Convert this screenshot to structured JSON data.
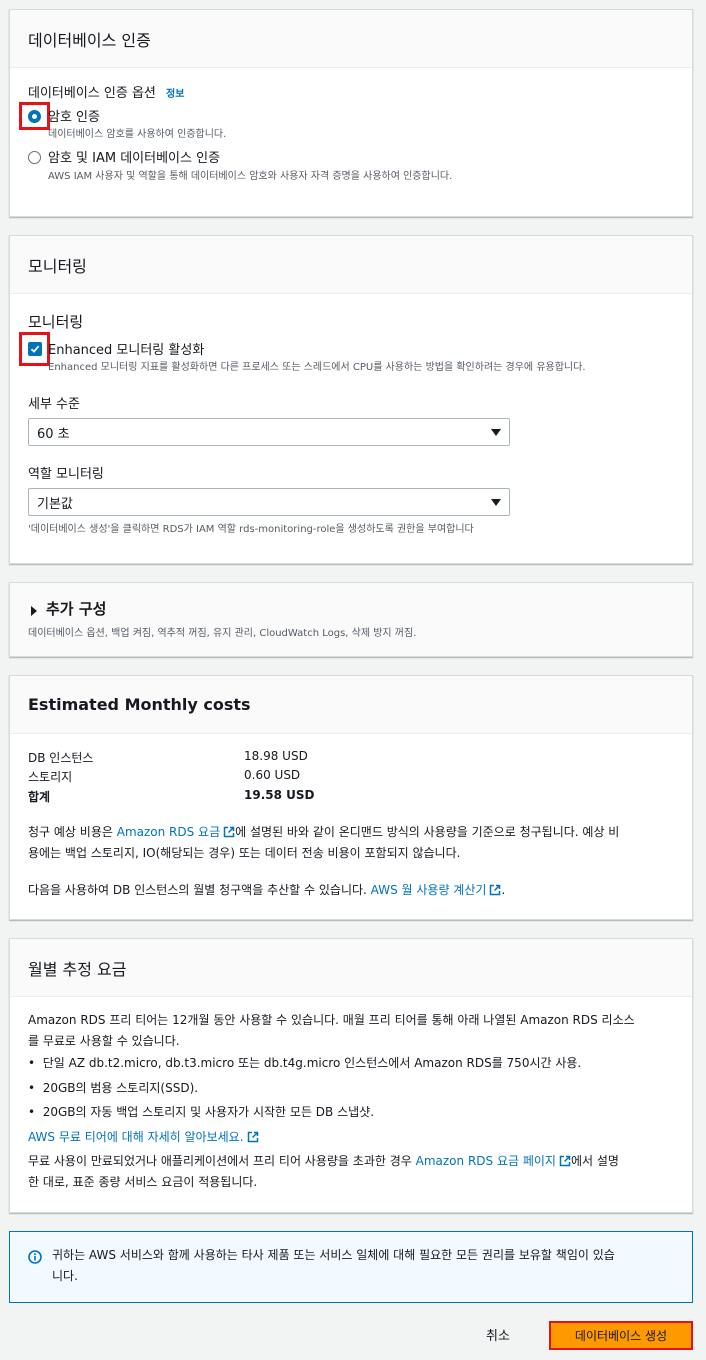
{
  "auth": {
    "title": "데이터베이스 인증",
    "options_label": "데이터베이스 인증 옵션",
    "info_link": "정보",
    "option1_label": "암호 인증",
    "option1_desc": "데이터베이스 암호를 사용하여 인증합니다.",
    "option2_label": "암호 및 IAM 데이터베이스 인증",
    "option2_desc": "AWS IAM 사용자 및 역할을 통해 데이터베이스 암호와 사용자 자격 증명을 사용하여 인증합니다."
  },
  "monitoring": {
    "title": "모니터링",
    "section_label": "모니터링",
    "enhanced_label": "Enhanced 모니터링 활성화",
    "enhanced_desc": "Enhanced 모니터링 지표를 활성화하면 다른 프로세스 또는 스레드에서 CPU를 사용하는 방법을 확인하려는 경우에 유용합니다.",
    "granularity_label": "세부 수준",
    "granularity_value": "60 초",
    "role_label": "역할 모니터링",
    "role_value": "기본값",
    "role_hint": "'데이터베이스 생성'을 클릭하면 RDS가 IAM 역할 rds-monitoring-role을 생성하도록 권한을 부여합니다"
  },
  "additional": {
    "title": "추가 구성",
    "desc": "데이터베이스 옵션, 백업 켜짐, 역추적 꺼짐, 유지 관리, CloudWatch Logs, 삭제 방지 꺼짐."
  },
  "costs": {
    "title": "Estimated Monthly costs",
    "rows": [
      {
        "label": "DB 인스턴스",
        "value": "18.98 USD"
      },
      {
        "label": "스토리지",
        "value": "0.60 USD"
      },
      {
        "label": "합계",
        "value": "19.58 USD"
      }
    ],
    "note1_a": "청구 예상 비용은 ",
    "note1_link": "Amazon RDS 요금",
    "note1_b": "에 설명된 바와 같이 온디맨드 방식의 사용량을 기준으로 청구됩니다. 예상 비",
    "note1_c": "용에는 백업 스토리지, IO(해당되는 경우) 또는 데이터 전송 비용이 포함되지 않습니다.",
    "note2_a": "다음을 사용하여 DB 인스턴스의 월별 청구액을 추산할 수 있습니다. ",
    "note2_link": "AWS 월 사용량 계산기",
    "note2_b": "."
  },
  "free_tier": {
    "title": "월별 추정 요금",
    "line1": "Amazon RDS 프리 티어는 12개월 동안 사용할 수 있습니다. 매월 프리 티어를 통해 아래 나열된 Amazon RDS 리소스",
    "line2": "를 무료로 사용할 수 있습니다.",
    "bullets": [
      "단일 AZ db.t2.micro, db.t3.micro 또는 db.t4g.micro 인스턴스에서 Amazon RDS를 750시간 사용.",
      "20GB의 범용 스토리지(SSD).",
      "20GB의 자동 백업 스토리지 및 사용자가 시작한 모든 DB 스냅샷."
    ],
    "learn_link": "AWS 무료 티어에 대해 자세히 알아보세요.",
    "tail_a": "무료 사용이 만료되었거나 애플리케이션에서 프리 티어 사용량을 초과한 경우 ",
    "tail_link": "Amazon RDS 요금 페이지",
    "tail_b": "에서 설명",
    "tail_c": "한 대로, 표준 종량 서비스 요금이 적용됩니다."
  },
  "info_alert": {
    "line1": "귀하는 AWS 서비스와 함께 사용하는 타사 제품 또는 서비스 일체에 대해 필요한 모든 권리를 보유할 책임이 있습",
    "line2": "니다."
  },
  "footer": {
    "cancel": "취소",
    "create": "데이터베이스 생성"
  },
  "colors": {
    "accent": "#0073bb",
    "primary_button": "#ff9900",
    "highlight": "#e5121a"
  }
}
